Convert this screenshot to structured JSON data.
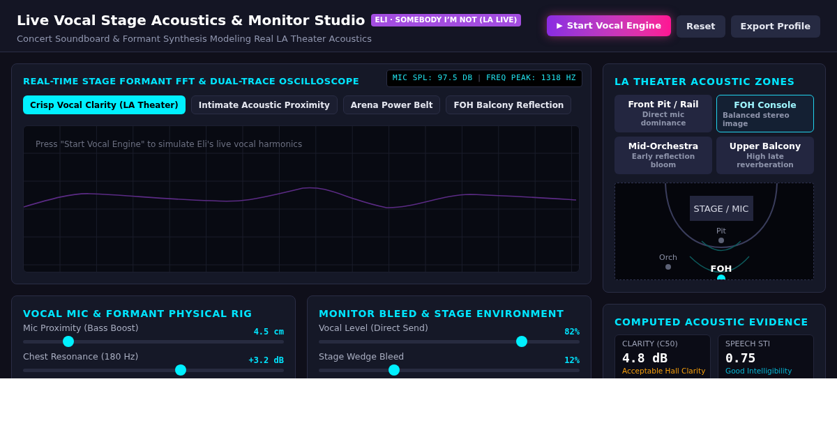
{
  "header": {
    "title": "Live Vocal Stage Acoustics & Monitor Studio",
    "badge": "ELI · SOMEBODY I’M NOT (LA LIVE)",
    "subtitle": "Concert Soundboard & Formant Synthesis Modeling Real LA Theater Acoustics",
    "buttons": [
      {
        "label": "Start Vocal Engine",
        "icon": "▶",
        "kind": "primary"
      },
      {
        "label": "Reset",
        "kind": "secondary"
      },
      {
        "label": "Export Profile",
        "kind": "secondary"
      }
    ]
  },
  "scope": {
    "title": "REAL-TIME STAGE FORMANT FFT & DUAL-TRACE OSCILLOSCOPE",
    "readout": [
      "MIC SPL: 97.5 DB",
      "FREQ PEAK: 1318 HZ"
    ],
    "separator": "|",
    "presets": [
      {
        "label": "Crisp Vocal Clarity (LA Theater)",
        "selected": true
      },
      {
        "label": "Intimate Acoustic Proximity",
        "selected": false
      },
      {
        "label": "Arena Power Belt",
        "selected": false
      },
      {
        "label": "FOH Balcony Reflection",
        "selected": false
      }
    ],
    "hint": "Press \"Start Vocal Engine\" to simulate Eli's live vocal harmonics"
  },
  "rigs": [
    {
      "title": "VOCAL MIC & FORMANT PHYSICAL RIG",
      "sliders": [
        {
          "label": "Mic Proximity (Bass Boost)",
          "reading": "4.5 cm",
          "level": 0.16
        },
        {
          "label": "Chest Resonance (180 Hz)",
          "reading": "+3.2 dB",
          "level": 0.61
        }
      ]
    },
    {
      "title": "MONITOR BLEED & STAGE ENVIRONMENT",
      "sliders": [
        {
          "label": "Vocal Level (Direct Send)",
          "reading": "82%",
          "level": 0.79
        },
        {
          "label": "Stage Wedge Bleed",
          "reading": "12%",
          "level": 0.28
        }
      ]
    }
  ],
  "zones": {
    "title": "LA THEATER ACOUSTIC ZONES",
    "items": [
      {
        "name": "Front Pit / Rail",
        "description": "Direct mic dominance",
        "selected": false
      },
      {
        "name": "FOH Console",
        "description": "Balanced stereo image",
        "selected": true
      },
      {
        "name": "Mid-Orchestra",
        "description": "Early reflection bloom",
        "selected": false
      },
      {
        "name": "Upper Balcony",
        "description": "High late reverberation",
        "selected": false
      }
    ],
    "map": {
      "stage": "STAGE / MIC",
      "pit": "Pit",
      "orch": "Orch",
      "foh": "FOH"
    }
  },
  "evidence": {
    "title": "COMPUTED ACOUSTIC EVIDENCE",
    "metrics": [
      {
        "label": "CLARITY (C50)",
        "value": "4.8 dB",
        "verdict": "Acceptable Hall Clarity",
        "color": "#f59e0b"
      },
      {
        "label": "SPEECH STI",
        "value": "0.75",
        "verdict": "Good Intelligibility",
        "color": "#06b6d4"
      }
    ]
  }
}
